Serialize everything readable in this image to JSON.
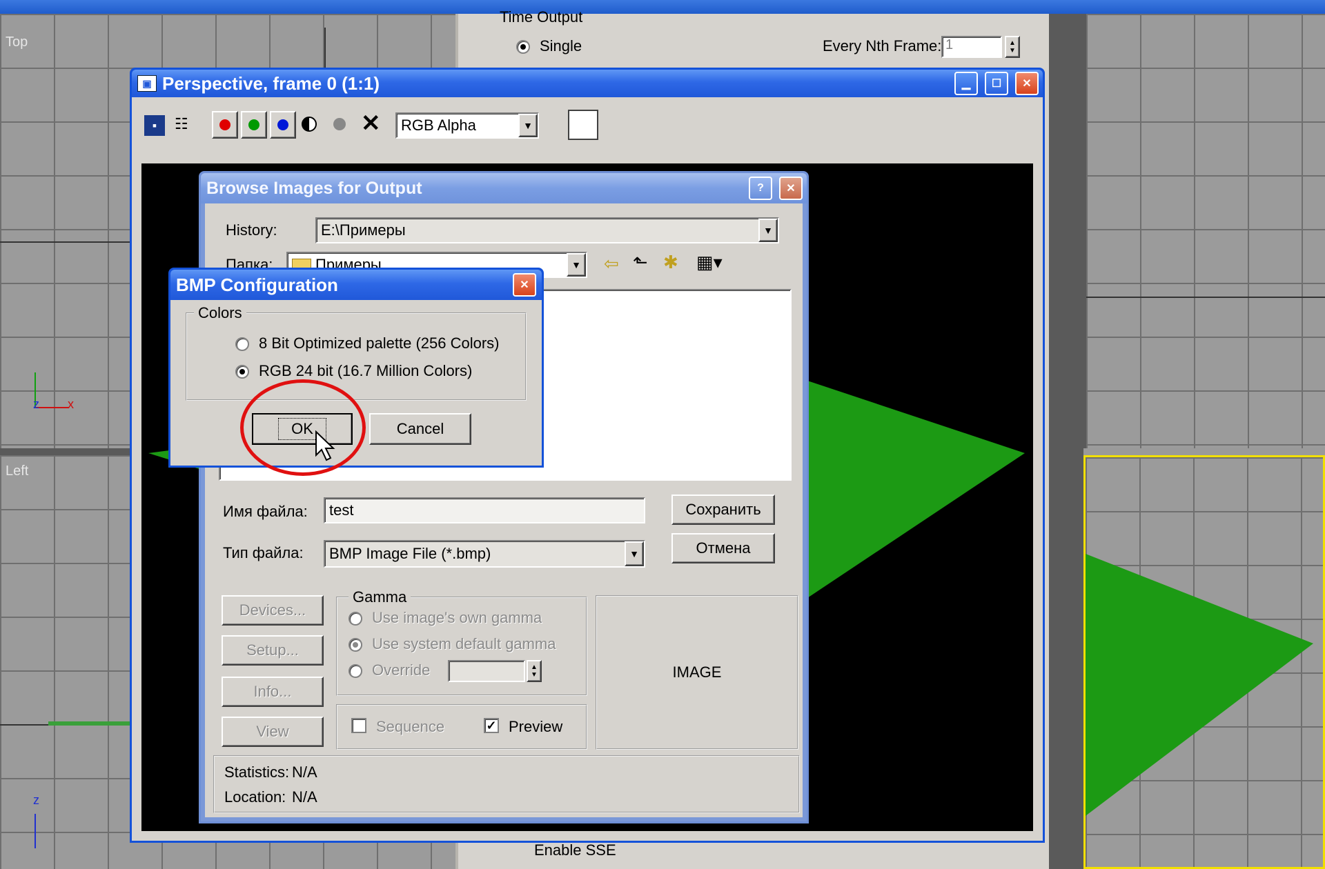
{
  "viewports": {
    "top_label": "Top",
    "left_label": "Left",
    "axis_x": "x",
    "axis_z": "z"
  },
  "render_settings": {
    "section_title": "Time Output",
    "single_label": "Single",
    "nth_frame_label": "Every Nth Frame:",
    "nth_frame_value": "1",
    "bottom_label": "Enable SSE"
  },
  "frame_window": {
    "title": "Perspective, frame 0 (1:1)",
    "channel_value": "RGB Alpha",
    "colors": {
      "red": "#e00000",
      "green": "#009a00",
      "blue": "#0018d8",
      "plane": "#1c9a14"
    }
  },
  "browse_dialog": {
    "title": "Browse Images for Output",
    "history_label": "History:",
    "history_value": "E:\\Примеры",
    "folder_label": "Папка:",
    "folder_value": "Примеры",
    "filename_label": "Имя файла:",
    "filename_value": "test",
    "filetype_label": "Тип файла:",
    "filetype_value": "BMP Image File (*.bmp)",
    "save_label": "Сохранить",
    "cancel_label": "Отмена",
    "devices_label": "Devices...",
    "setup_label": "Setup...",
    "info_label": "Info...",
    "view_label": "View",
    "gamma_title": "Gamma",
    "gamma_own": "Use image's own gamma",
    "gamma_system": "Use system default gamma",
    "gamma_override": "Override",
    "sequence_label": "Sequence",
    "preview_label": "Preview",
    "image_label": "IMAGE",
    "statistics_label": "Statistics:",
    "statistics_value": "N/A",
    "location_label": "Location:",
    "location_value": "N/A"
  },
  "bmp_dialog": {
    "title": "BMP Configuration",
    "colors_group": "Colors",
    "option_8bit": "8 Bit Optimized palette  (256 Colors)",
    "option_24bit": "RGB 24 bit  (16.7 Million Colors)",
    "ok_label": "OK",
    "cancel_label": "Cancel",
    "highlight_color": "#e01010"
  }
}
